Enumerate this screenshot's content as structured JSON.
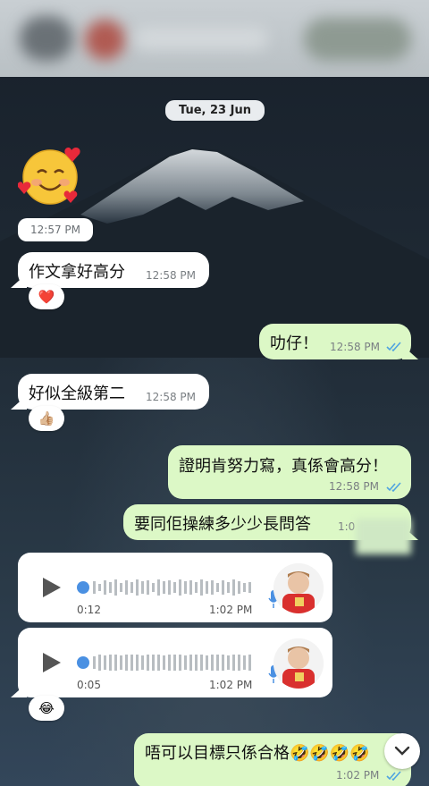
{
  "date_separator": "Tue, 23 Jun",
  "messages": {
    "emoji_time": "12:57 PM",
    "m1": {
      "text": "作文拿好高分",
      "time": "12:58 PM",
      "reaction": "❤️"
    },
    "m2": {
      "text": "叻仔！",
      "time": "12:58 PM"
    },
    "m3": {
      "text": "好似全級第二",
      "time": "12:58 PM",
      "reaction": "👍🏼"
    },
    "m4": {
      "text": "證明肯努力寫，真係會高分！",
      "time": "12:58 PM"
    },
    "m5": {
      "text": "要同佢操練多少少長問答",
      "time": "1:0"
    },
    "voice1": {
      "duration": "0:12",
      "time": "1:02 PM"
    },
    "voice2": {
      "duration": "0:05",
      "time": "1:02 PM",
      "reaction": "😂"
    },
    "m6": {
      "text": "唔可以目標只係合格🤣🤣🤣🤣",
      "time": "1:02 PM"
    }
  },
  "colors": {
    "incoming": "#ffffff",
    "outgoing": "#dcf8c6",
    "read_ticks": "#4fa3e0",
    "voice_accent": "#4a90e2"
  },
  "icons": [
    "smiling-face-with-hearts-icon",
    "play-icon",
    "microphone-icon",
    "double-check-icon",
    "chevron-down-icon"
  ]
}
